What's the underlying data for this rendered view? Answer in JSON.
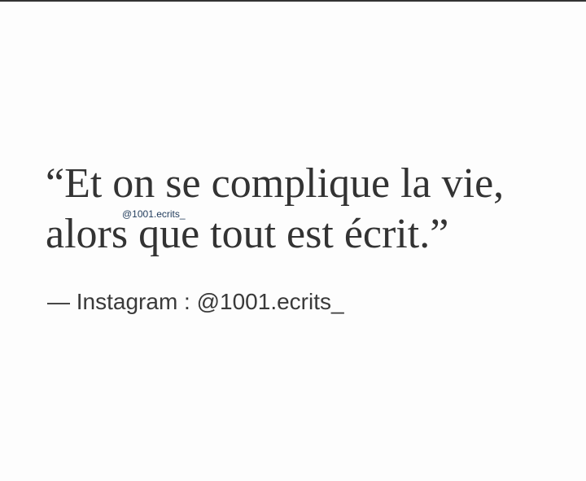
{
  "quote": {
    "line1": "“Et on se complique la vie,",
    "line2": "alors que tout est écrit.”"
  },
  "watermark": "@1001.ecrits_",
  "attribution": "— Instagram : @1001.ecrits_"
}
